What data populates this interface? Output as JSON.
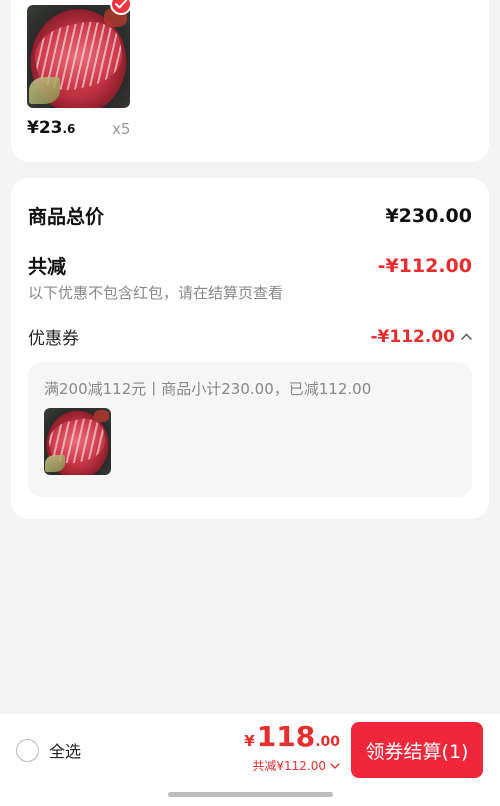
{
  "product": {
    "price_main": "¥23",
    "price_decimal": ".6",
    "quantity": "x5",
    "selected": true
  },
  "summary": {
    "total_label": "商品总价",
    "total_value": "¥230.00",
    "discount_label": "共减",
    "discount_value": "-¥112.00",
    "discount_note": "以下优惠不包含红包，请在结算页查看",
    "coupon_label": "优惠券",
    "coupon_value": "-¥112.00",
    "coupon_desc": "满200减112元丨商品小计230.00，已减112.00"
  },
  "bottom_bar": {
    "select_all_label": "全选",
    "currency": "¥",
    "total_int": "118",
    "total_dec": ".00",
    "discount_summary": "共减¥112.00",
    "checkout_label": "领券结算(1)"
  },
  "colors": {
    "accent_red": "#e62e2e",
    "button_red": "#f0263a",
    "background": "#f4f4f4"
  },
  "icons": [
    "check-icon",
    "chevron-up-icon",
    "chevron-down-icon"
  ]
}
